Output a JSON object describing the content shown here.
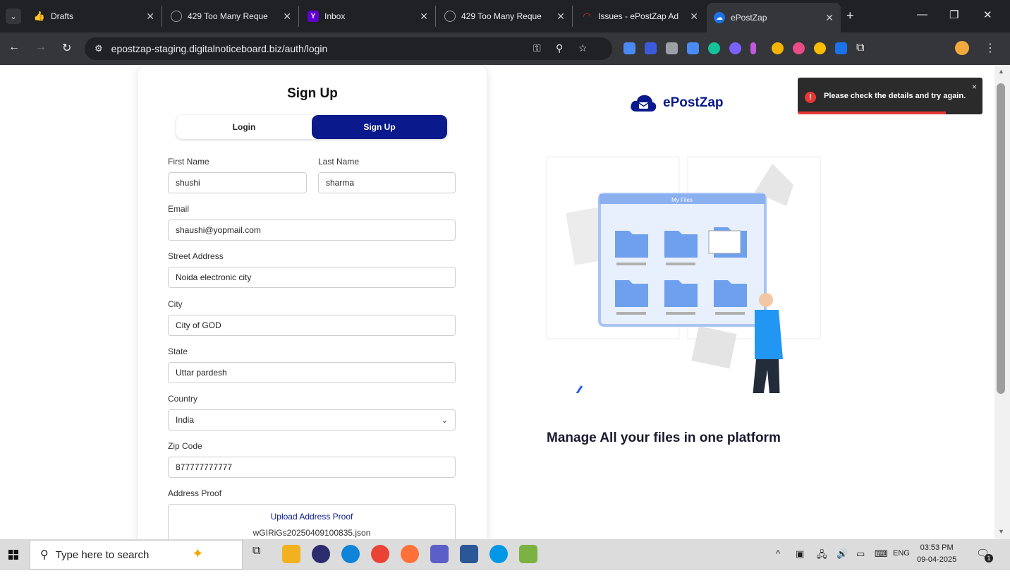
{
  "browser": {
    "tabs": [
      {
        "title": "Drafts",
        "color": "#e8eaed"
      },
      {
        "title": "429 Too Many Reque",
        "color": "#5f6368"
      },
      {
        "title": "Inbox",
        "color": "#6001d2"
      },
      {
        "title": "429 Too Many Reque",
        "color": "#5f6368"
      },
      {
        "title": "Issues - ePostZap Ad",
        "color": "#d93025"
      },
      {
        "title": "ePostZap",
        "color": "#1a73e8"
      }
    ],
    "url": "epostzap-staging.digitalnoticeboard.biz/auth/login"
  },
  "form": {
    "title": "Sign Up",
    "tab_login": "Login",
    "tab_signup": "Sign Up",
    "first_name_label": "First Name",
    "first_name_value": "shushi",
    "last_name_label": "Last Name",
    "last_name_value": "sharma",
    "email_label": "Email",
    "email_value": "shaushi@yopmail.com",
    "street_label": "Street Address",
    "street_value": "Noida electronic city",
    "city_label": "City",
    "city_value": "City of GOD",
    "state_label": "State",
    "state_value": "Uttar pardesh",
    "country_label": "Country",
    "country_value": "India",
    "zip_label": "Zip Code",
    "zip_value": "877777777777",
    "proof_label": "Address Proof",
    "upload_label": "Upload Address Proof",
    "file_name": "wGIRiGs20250409100835.json"
  },
  "brand": {
    "name": "ePostZap",
    "tagline": "Manage All your files in one platform",
    "illustration_title": "My Files",
    "color": "#0a1a8c"
  },
  "toast": {
    "message": "Please check the details and try again.",
    "close": "×"
  },
  "taskbar": {
    "search_placeholder": "Type here to search",
    "lang": "ENG",
    "time": "03:53 PM",
    "date": "09-04-2025",
    "notification_count": "1"
  }
}
